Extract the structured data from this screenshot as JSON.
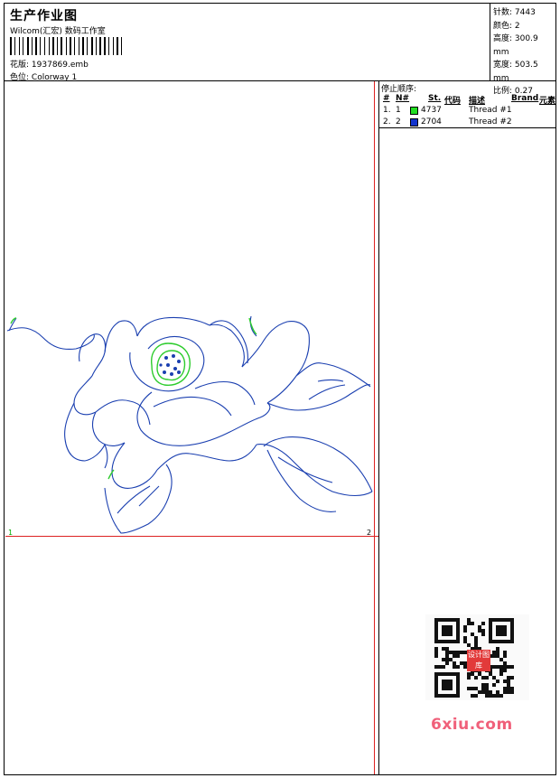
{
  "header": {
    "title": "生产作业图",
    "subtitle": "Wilcom(汇宏) 数码工作室",
    "design_label": "花版:",
    "design_value": "1937869.emb",
    "colorway_label": "色位:",
    "colorway_value": "Colorway 1"
  },
  "stats": {
    "stitches_label": "针数:",
    "stitches_value": "7443",
    "colors_label": "颜色:",
    "colors_value": "2",
    "height_label": "高度:",
    "height_value": "300.9 mm",
    "width_label": "宽度:",
    "width_value": "503.5 mm",
    "scale_label": "比例:",
    "scale_value": "0.27"
  },
  "stop_sequence": {
    "title": "停止顺序:",
    "headers": {
      "num": "#",
      "n": "N#",
      "st": "St.",
      "code": "代码",
      "desc": "描述",
      "brand": "Brand",
      "element": "元素"
    },
    "rows": [
      {
        "num": "1.",
        "n": "1",
        "code": "4737",
        "desc": "Thread #1",
        "color": "#22dd22"
      },
      {
        "num": "2.",
        "n": "2",
        "code": "2704",
        "desc": "Thread #2",
        "color": "#1133cc"
      }
    ]
  },
  "canvas": {
    "corner_left": "1",
    "corner_right": "2"
  },
  "colors": {
    "guide_red": "#d22222",
    "outline_blue": "#1a3fb0",
    "outline_green": "#2ecc2e"
  },
  "watermark": {
    "site": "6xiu.com",
    "stamp": "设计图库"
  }
}
